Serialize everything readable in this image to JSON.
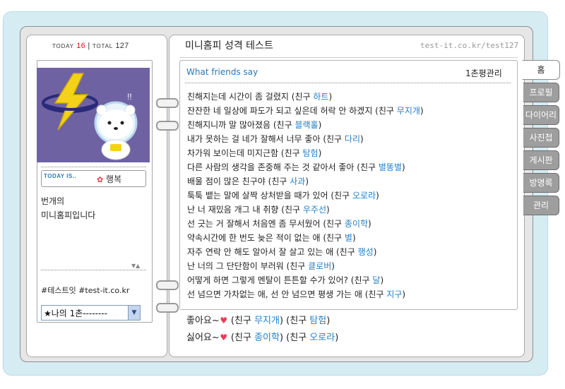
{
  "counter": {
    "today_label": "TODAY",
    "today_count": "16",
    "separator": "|",
    "total_label": "TOTAL",
    "total_count": "127"
  },
  "profile": {
    "today_label": "TODAY IS..",
    "today_mood": "행복",
    "intro_line1": "번개의",
    "intro_line2": "미니홈피입니다",
    "tags": "#테스트잇 #test-it.co.kr",
    "dropdown_value": "★나의 1촌--------"
  },
  "header": {
    "title": "미니홈피 성격 테스트",
    "url": "test-it.co.kr/test127"
  },
  "board": {
    "title": "What friends say",
    "manage_label": "1촌평관리",
    "friend_label": "친구",
    "comments": [
      {
        "text": "친해지는데 시간이 좀 걸렸지",
        "friend": "하트"
      },
      {
        "text": "잔잔한 네 일상에 파도가 되고 싶은데 허락 안 하겠지",
        "friend": "무지개"
      },
      {
        "text": "친해지니까 말 많아졌음",
        "friend": "블랙홀"
      },
      {
        "text": "내가 못하는 걸 네가 잘해서 너무 좋아",
        "friend": "다리"
      },
      {
        "text": "차가워 보이는데 미지근함",
        "friend": "탐험"
      },
      {
        "text": "다른 사람의 생각을 존중해 주는 것 같아서 좋아",
        "friend": "별똥별"
      },
      {
        "text": "배울 점이 많은 친구야",
        "friend": "사과"
      },
      {
        "text": "툭툭 뱉는 말에 살짝 상처받을 때가 있어",
        "friend": "오로라"
      },
      {
        "text": "난 너 재밌음 개그 내 취향",
        "friend": "우주선"
      },
      {
        "text": "선 긋는 거 잘해서 처음엔 좀 무서웠어",
        "friend": "종이학"
      },
      {
        "text": "약속시간에 한 번도 늦은 적이 없는 애",
        "friend": "별"
      },
      {
        "text": "자주 연락 안 해도 알아서 잘 살고 있는 애",
        "friend": "행성"
      },
      {
        "text": "난 너의 그 단단함이 부러워",
        "friend": "클로버"
      },
      {
        "text": "어떻게 하면 그렇게 멘탈이 튼튼할 수가 있어?",
        "friend": "달"
      },
      {
        "text": "선 넘으면 가차없는 애, 선 안 넘으면 평생 가는 애",
        "friend": "지구"
      }
    ]
  },
  "likes": {
    "like_label": "좋아요~",
    "like_friends": [
      "무지개",
      "탐험"
    ],
    "dislike_label": "싫어요~",
    "dislike_friends": [
      "종이학",
      "오로라"
    ],
    "friend_label": "친구"
  },
  "tabs": [
    "홈",
    "프로필",
    "다이어리",
    "사진첩",
    "게시판",
    "방명록",
    "관리"
  ],
  "colors": {
    "accent_blue": "#2480c9",
    "tab_gray": "#9e9e9e",
    "frame_blue": "#d5ecf2",
    "photo_bg": "#6f62a3",
    "heart": "#ea3b56"
  }
}
